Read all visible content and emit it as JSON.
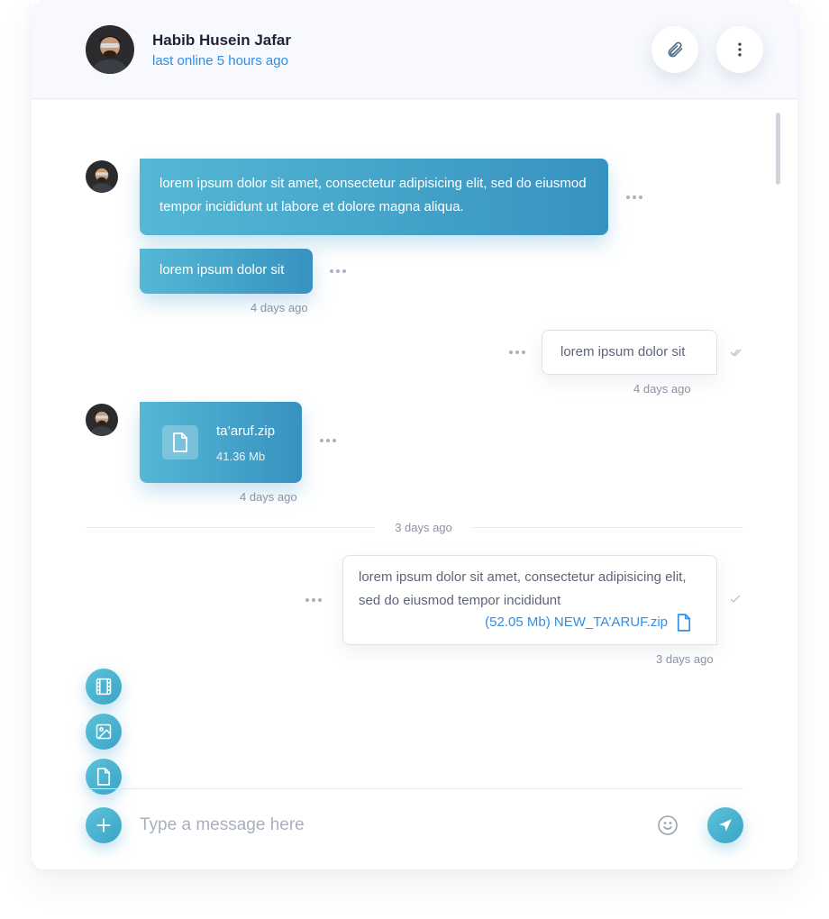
{
  "header": {
    "name": "Habib Husein Jafar",
    "status": "last online 5 hours ago"
  },
  "messages": {
    "m1": {
      "text": "lorem ipsum dolor sit amet, consectetur adipisicing elit, sed do eiusmod tempor incididunt ut labore et dolore magna aliqua."
    },
    "m2": {
      "text": "lorem ipsum dolor sit",
      "time": "4 days ago"
    },
    "m3": {
      "text": "lorem ipsum dolor sit",
      "time": "4 days ago"
    },
    "m4": {
      "file_name": "ta’aruf.zip",
      "file_size": "41.36 Mb",
      "time": "4 days ago"
    },
    "divider": "3 days ago",
    "m5": {
      "text": "lorem ipsum dolor sit amet, consectetur adipisicing elit, sed do eiusmod tempor incididunt",
      "attachment": "(52.05 Mb) NEW_TA’ARUF.zip",
      "time": "3 days ago"
    }
  },
  "composer": {
    "placeholder": "Type a message here"
  },
  "icons": {
    "attach": "paperclip-icon",
    "menu": "more-vertical-icon",
    "film": "film-icon",
    "image": "image-icon",
    "file": "file-icon",
    "plus": "plus-icon",
    "emoji": "smile-icon",
    "send": "send-icon"
  },
  "colors": {
    "accent": "#2f8ee6",
    "bubble_gradient_start": "#55b8d5",
    "bubble_gradient_end": "#3792c0"
  }
}
